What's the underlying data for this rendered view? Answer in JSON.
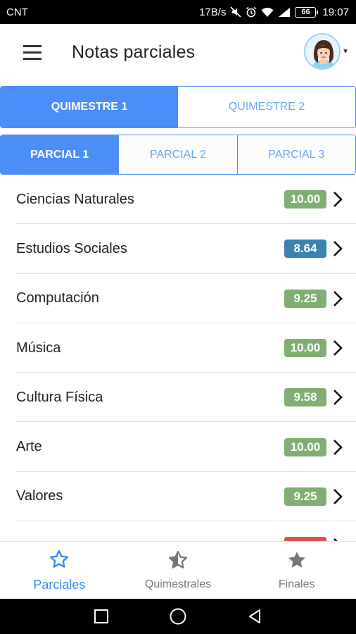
{
  "status_bar": {
    "carrier": "CNT",
    "speed": "17B/s",
    "battery": "66",
    "time": "19:07"
  },
  "app_bar": {
    "title": "Notas parciales"
  },
  "quimestre_tabs": [
    {
      "label": "QUIMESTRE 1",
      "active": true
    },
    {
      "label": "QUIMESTRE 2",
      "active": false
    }
  ],
  "parcial_tabs": [
    {
      "label": "PARCIAL 1",
      "active": true
    },
    {
      "label": "PARCIAL 2",
      "active": false
    },
    {
      "label": "PARCIAL 3",
      "active": false
    }
  ],
  "subjects": [
    {
      "name": "Ciencias Naturales",
      "grade": "10.00",
      "color": "#7fae72"
    },
    {
      "name": "Estudios Sociales",
      "grade": "8.64",
      "color": "#3a82b0"
    },
    {
      "name": "Computación",
      "grade": "9.25",
      "color": "#7fae72"
    },
    {
      "name": "Música",
      "grade": "10.00",
      "color": "#7fae72"
    },
    {
      "name": "Cultura Física",
      "grade": "9.58",
      "color": "#7fae72"
    },
    {
      "name": "Arte",
      "grade": "10.00",
      "color": "#7fae72"
    },
    {
      "name": "Valores",
      "grade": "9.25",
      "color": "#7fae72"
    },
    {
      "name": "",
      "grade": "",
      "color": "#d9534f"
    }
  ],
  "bottom_nav": [
    {
      "label": "Parciales",
      "icon": "star-outline-icon",
      "active": true
    },
    {
      "label": "Quimestrales",
      "icon": "star-half-icon",
      "active": false
    },
    {
      "label": "Finales",
      "icon": "star-filled-icon",
      "active": false
    }
  ],
  "colors": {
    "accent": "#4b8ef8",
    "nav_active": "#3a86f5",
    "grade_good": "#7fae72",
    "grade_mid": "#3a82b0",
    "grade_low": "#d9534f"
  }
}
